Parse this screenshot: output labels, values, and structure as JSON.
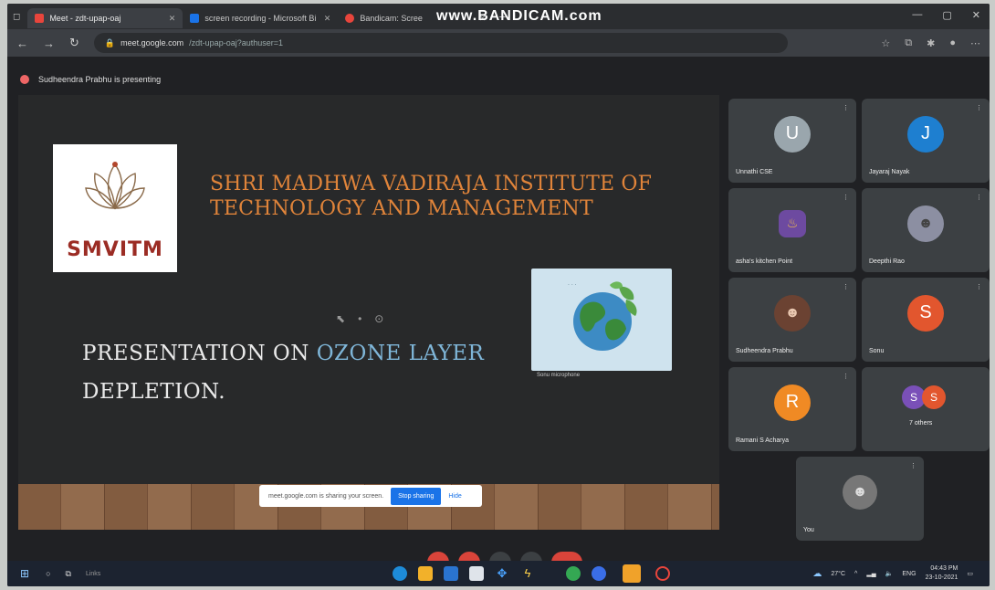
{
  "browser": {
    "tabs": [
      {
        "label": "Meet - zdt-upap-oaj",
        "color": "#e8453c",
        "active": true
      },
      {
        "label": "screen recording - Microsoft Bi",
        "color": "#1a73e8",
        "active": false
      },
      {
        "label": "Bandicam: Scree",
        "color": "#e8453c",
        "active": false
      }
    ],
    "watermark": "www.BANDICAM.com",
    "url_domain": "meet.google.com",
    "url_path": "/zdt-upap-oaj?authuser=1"
  },
  "meeting": {
    "presenting_text": "Sudheendra Prabhu is presenting"
  },
  "slide": {
    "logo_text": "SMVITM",
    "institute_line1": "SHRI MADHWA VADIRAJA INSTITUTE OF",
    "institute_line2": "TECHNOLOGY AND MANAGEMENT",
    "title_part1": "PRESENTATION ON ",
    "title_highlight": "OZONE LAYER",
    "title_line2": "DEPLETION.",
    "camera_label": "Sonu microphone"
  },
  "share_bar": {
    "text": "meet.google.com is sharing your screen.",
    "stop_label": "Stop sharing",
    "hide_label": "Hide"
  },
  "participants": [
    {
      "name": "Unnathi CSE",
      "initial": "U",
      "color": "#9aa6ad"
    },
    {
      "name": "Jayaraj Nayak",
      "initial": "J",
      "color": "#1e7fd0"
    },
    {
      "name": "asha's kitchen Point",
      "initial": "",
      "color": "#6d4aa0"
    },
    {
      "name": "Deepthi Rao",
      "initial": "",
      "color": "#8c8fa2"
    },
    {
      "name": "Sudheendra Prabhu",
      "initial": "",
      "color": "#6b4232"
    },
    {
      "name": "Sonu",
      "initial": "S",
      "color": "#e2562e"
    },
    {
      "name": "Ramani S Acharya",
      "initial": "R",
      "color": "#f08a24"
    },
    {
      "name": "7 others",
      "initial": "",
      "color": "#7a50b8"
    },
    {
      "name": "You",
      "initial": "",
      "color": "#777777"
    }
  ],
  "taskbar": {
    "search": "Links",
    "weather": "27°C",
    "lang": "ENG",
    "time": "04:43 PM",
    "date": "23-10-2021"
  }
}
